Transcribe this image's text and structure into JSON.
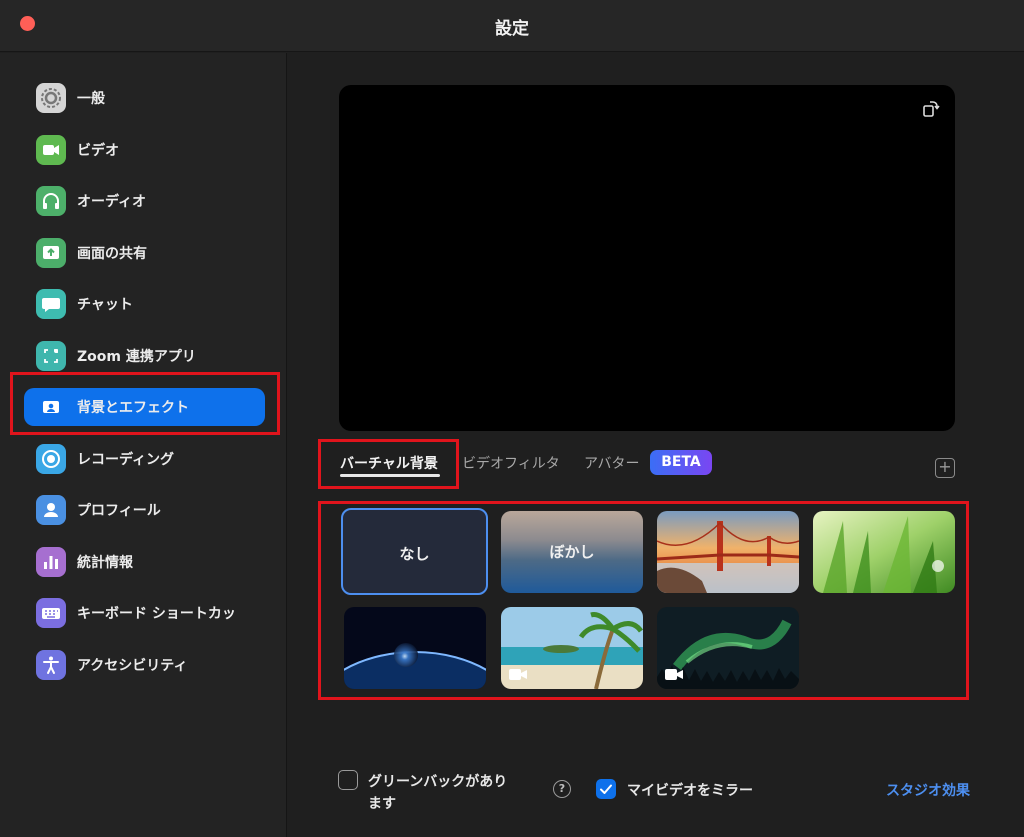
{
  "window": {
    "title": "設定"
  },
  "sidebar": {
    "items": [
      {
        "label": "一般",
        "icon": "gear-icon",
        "color": "#d5d5d5"
      },
      {
        "label": "ビデオ",
        "icon": "video-camera-icon",
        "color": "#5fb950"
      },
      {
        "label": "オーディオ",
        "icon": "headphones-icon",
        "color": "#4db06a"
      },
      {
        "label": "画面の共有",
        "icon": "share-screen-icon",
        "color": "#4cae6a"
      },
      {
        "label": "チャット",
        "icon": "chat-bubble-icon",
        "color": "#3ebcb0"
      },
      {
        "label": "Zoom 連携アプリ",
        "icon": "apps-icon",
        "color": "#3fb6ad"
      },
      {
        "label": "背景とエフェクト",
        "icon": "background-portrait-icon",
        "color": "#0e71eb",
        "active": true
      },
      {
        "label": "レコーディング",
        "icon": "record-icon",
        "color": "#3aa7e6"
      },
      {
        "label": "プロフィール",
        "icon": "profile-icon",
        "color": "#4a90e2"
      },
      {
        "label": "統計情報",
        "icon": "statistics-icon",
        "color": "#a66fd0"
      },
      {
        "label": "キーボード ショートカッ",
        "icon": "keyboard-icon",
        "color": "#7b6ee0"
      },
      {
        "label": "アクセシビリティ",
        "icon": "accessibility-icon",
        "color": "#6f73e0"
      }
    ]
  },
  "tabs": [
    {
      "label": "バーチャル背景",
      "active": true
    },
    {
      "label": "ビデオフィルタ"
    },
    {
      "label": "アバター"
    }
  ],
  "beta_badge": "BETA",
  "backgrounds": [
    {
      "label": "なし",
      "kind": "none",
      "selected": true
    },
    {
      "label": "ぼかし",
      "kind": "blur"
    },
    {
      "label": "",
      "kind": "golden-gate-bridge"
    },
    {
      "label": "",
      "kind": "grass"
    },
    {
      "label": "",
      "kind": "earth-from-space"
    },
    {
      "label": "",
      "kind": "beach-palm",
      "video": true
    },
    {
      "label": "",
      "kind": "aurora",
      "video": true
    }
  ],
  "footer": {
    "green_screen_label_line1": "グリーンバックがあり",
    "green_screen_label_line2": "ます",
    "green_screen_checked": false,
    "mirror_label": "マイビデオをミラー",
    "mirror_checked": true,
    "studio_link": "スタジオ効果"
  },
  "colors": {
    "accent": "#0e71eb",
    "highlight": "#e0141c",
    "link": "#4d8ff0"
  }
}
